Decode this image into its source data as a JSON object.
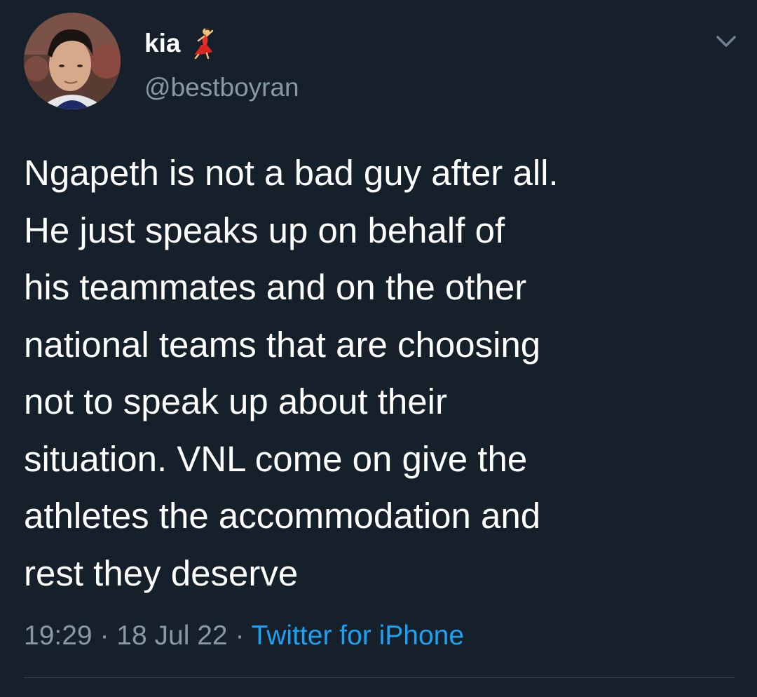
{
  "tweet": {
    "display_name": "kia",
    "name_emoji": "dancer-emoji",
    "handle": "@bestboyran",
    "text": "Ngapeth is not a bad guy after all.\nHe just speaks up on behalf of\nhis teammates and on the other\nnational teams that are choosing\nnot to speak up about their\nsituation. VNL come on give the\nathletes the accommodation and\nrest they deserve",
    "time": "19:29",
    "separator": "·",
    "date": "18 Jul 22",
    "source": "Twitter for iPhone"
  },
  "icons": {
    "menu": "chevron-down-icon",
    "avatar": "avatar"
  },
  "colors": {
    "background": "#15202b",
    "text": "#ffffff",
    "secondary_text": "#8899a6",
    "link": "#1da1f2",
    "divider": "#38444d"
  }
}
